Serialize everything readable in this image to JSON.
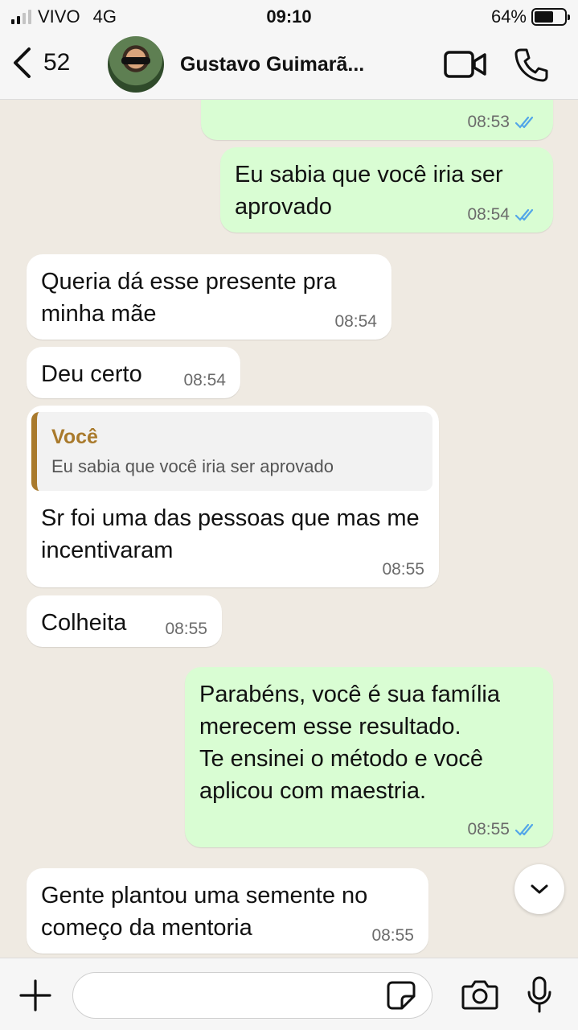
{
  "status_bar": {
    "carrier": "VIVO",
    "network": "4G",
    "time": "09:10",
    "battery_percent": "64%",
    "battery_level": 0.64
  },
  "header": {
    "back_count": "52",
    "contact_name": "Gustavo Guimarã..."
  },
  "messages": [
    {
      "direction": "out",
      "text": "",
      "time": "08:53",
      "read": true
    },
    {
      "direction": "out",
      "text": "Eu sabia que você iria ser aprovado",
      "time": "08:54",
      "read": true
    },
    {
      "direction": "in",
      "text": "Queria dá esse presente pra minha mãe",
      "time": "08:54"
    },
    {
      "direction": "in",
      "text": "Deu certo",
      "time": "08:54"
    },
    {
      "direction": "in",
      "quote_author": "Você",
      "quote_text": "Eu sabia que você iria ser aprovado",
      "text": "Sr foi uma das pessoas que mas me incentivaram",
      "time": "08:55"
    },
    {
      "direction": "in",
      "text": "Colheita",
      "time": "08:55"
    },
    {
      "direction": "out",
      "text": "Parabéns, você é sua família merecem esse resultado.\nTe ensinei o método e você aplicou com maestria.",
      "time": "08:55",
      "read": true
    },
    {
      "direction": "in",
      "text": "Gente plantou uma semente no começo da mentoria",
      "time": "08:55"
    }
  ],
  "colors": {
    "outgoing_bubble": "#d9fdd3",
    "incoming_bubble": "#ffffff",
    "read_ticks": "#53a6e8",
    "quote_accent": "#a97a2c",
    "chat_background": "#efeae2"
  },
  "input": {
    "placeholder": ""
  },
  "icons": {
    "back": "chevron-left-icon",
    "video": "video-camera-icon",
    "call": "phone-icon",
    "scroll_down": "chevron-down-icon",
    "plus": "plus-icon",
    "sticker": "sticker-icon",
    "camera": "camera-icon",
    "mic": "microphone-icon"
  }
}
